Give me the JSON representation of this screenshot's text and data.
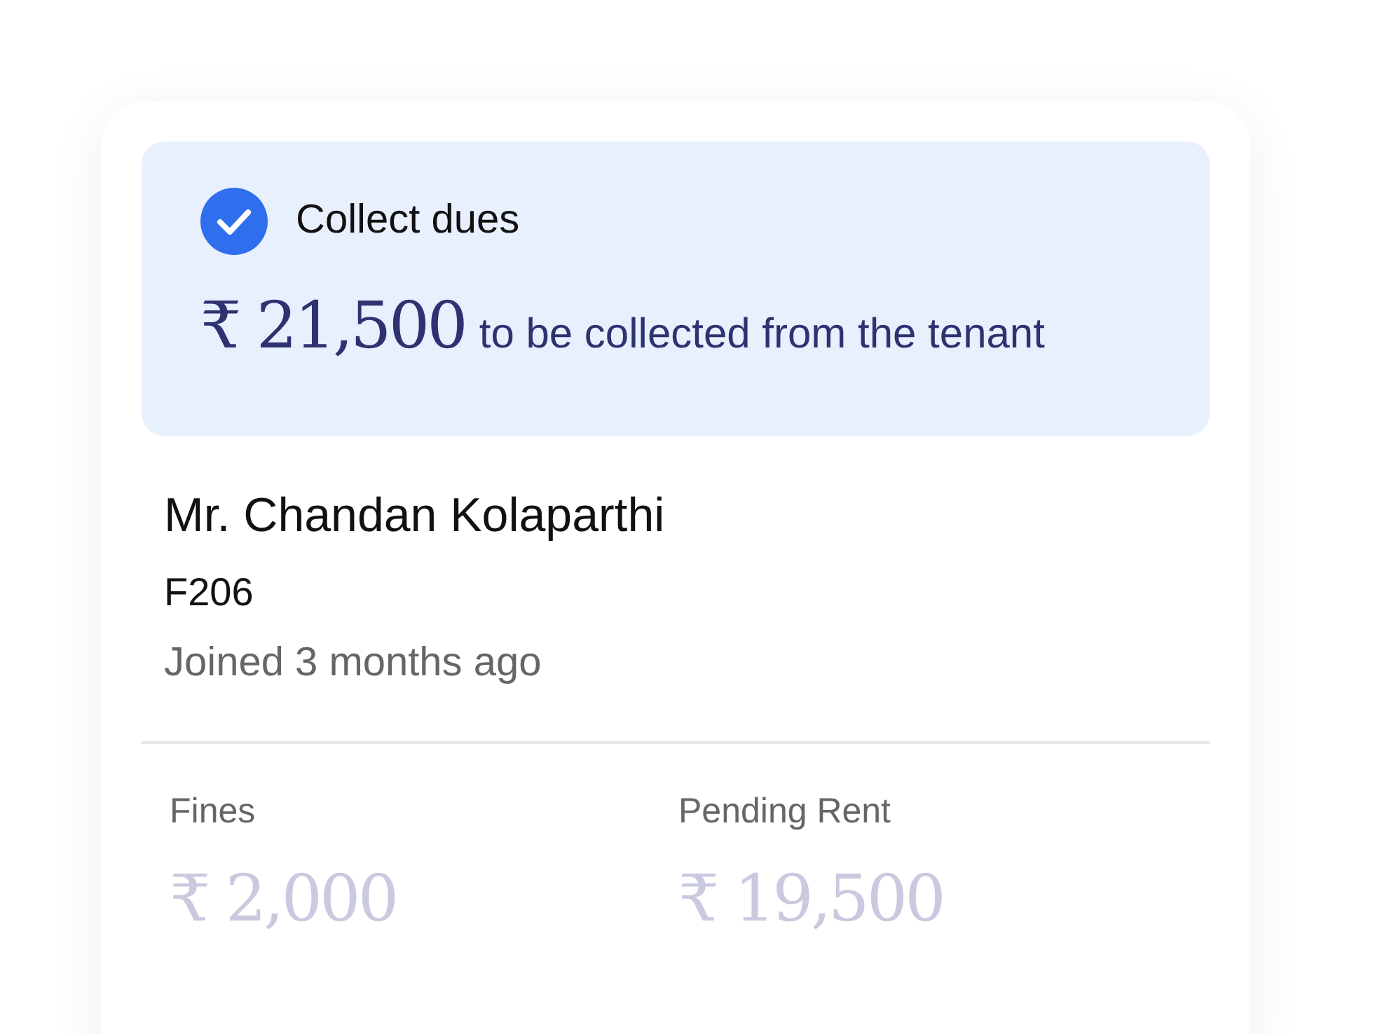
{
  "dues": {
    "title": "Collect dues",
    "checked": true,
    "currency": "₹",
    "amount": "21,500",
    "caption": "to be collected from the tenant"
  },
  "tenant": {
    "name": "Mr. Chandan Kolaparthi",
    "unit": "F206",
    "joined": "Joined 3 months ago"
  },
  "breakdown": [
    {
      "label": "Fines",
      "currency": "₹",
      "amount": "2,000"
    },
    {
      "label": "Pending Rent",
      "currency": "₹",
      "amount": "19,500"
    }
  ]
}
